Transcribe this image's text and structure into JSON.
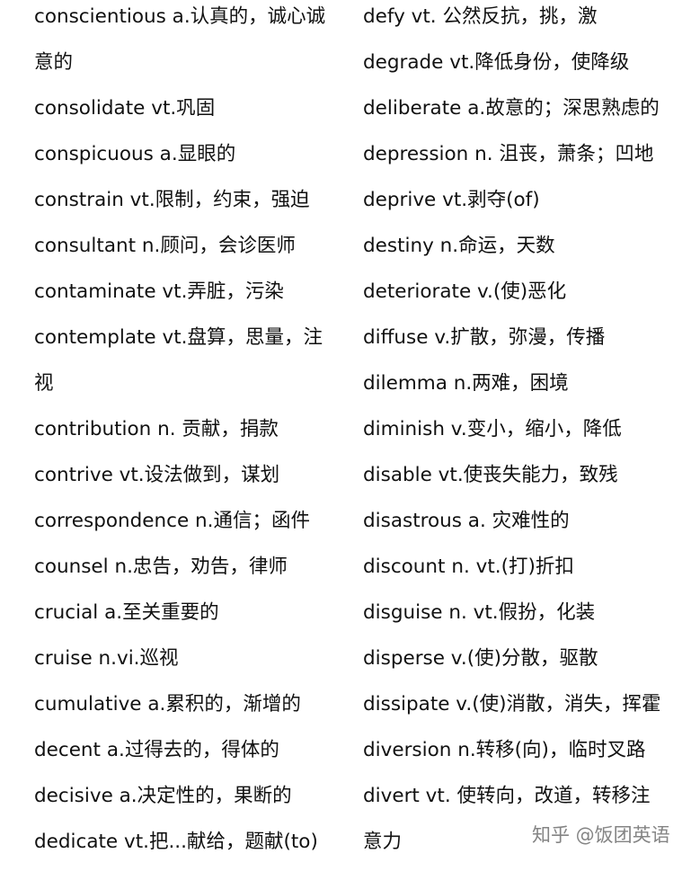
{
  "left_column": [
    "conscientious a.认真的，诚心诚",
    "意的",
    "consolidate vt.巩固",
    "conspicuous a.显眼的",
    "constrain vt.限制，约束，强迫",
    "consultant n.顾问，会诊医师",
    "contaminate vt.弄脏，污染",
    "contemplate vt.盘算，思量，注",
    "视",
    "contribution n. 贡献，捐款",
    "contrive vt.设法做到，谋划",
    "correspondence n.通信；函件",
    "counsel n.忠告，劝告，律师",
    "crucial a.至关重要的",
    "cruise n.vi.巡视",
    "cumulative a.累积的，渐增的",
    "decent a.过得去的，得体的",
    "decisive a.决定性的，果断的",
    "dedicate vt.把...献给，题献(to)"
  ],
  "right_column": [
    "defy vt. 公然反抗，挑，激",
    "degrade vt.降低身份，使降级",
    "deliberate a.故意的；深思熟虑的",
    "depression n. 沮丧，萧条；凹地",
    "deprive vt.剥夺(of)",
    "destiny n.命运，天数",
    "deteriorate v.(使)恶化",
    "diffuse v.扩散，弥漫，传播",
    "dilemma n.两难，困境",
    "diminish v.变小，缩小，降低",
    "disable vt.使丧失能力，致残",
    "disastrous a. 灾难性的",
    "discount    n. vt.(打)折扣",
    "disguise n.    vt.假扮，化装",
    "disperse v.(使)分散，驱散",
    "dissipate v.(使)消散，消失，挥霍",
    "diversion n.转移(向)，临时叉路",
    "divert vt. 使转向，改道，转移注",
    "意力"
  ],
  "watermark": "知乎 @饭团英语"
}
